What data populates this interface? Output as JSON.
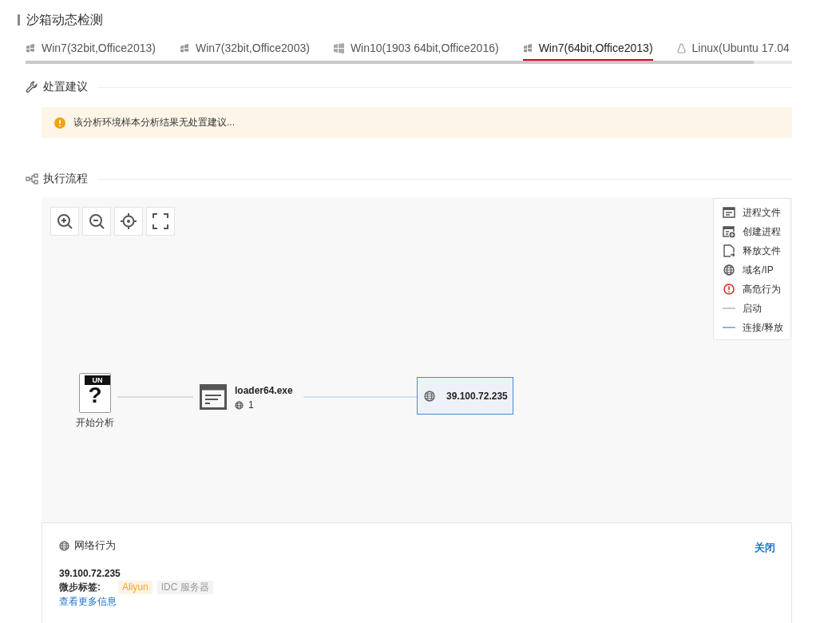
{
  "page_title": "沙箱动态检测",
  "tabs": [
    {
      "label": "Win7(32bit,Office2013)",
      "kind": "windows7",
      "selected": false
    },
    {
      "label": "Win7(32bit,Office2003)",
      "kind": "windows7",
      "selected": false
    },
    {
      "label": "Win10(1903 64bit,Office2016)",
      "kind": "windows10",
      "selected": false
    },
    {
      "label": "Win7(64bit,Office2013)",
      "kind": "windows7",
      "selected": true
    },
    {
      "label": "Linux(Ubuntu 17.04",
      "kind": "linux",
      "selected": false
    }
  ],
  "advice": {
    "title": "处置建议",
    "message": "该分析环境样本分析结果无处置建议..."
  },
  "flow": {
    "title": "执行流程",
    "legend": [
      {
        "kind": "process-file",
        "label": "进程文件"
      },
      {
        "kind": "create-process",
        "label": "创建进程"
      },
      {
        "kind": "release-file",
        "label": "释放文件"
      },
      {
        "kind": "domain",
        "label": "域名/IP"
      },
      {
        "kind": "danger",
        "label": "高危行为"
      },
      {
        "kind": "start-line",
        "label": "启动"
      },
      {
        "kind": "connect-line",
        "label": "连接/释放"
      }
    ],
    "start_node": {
      "badge": "UN",
      "symbol": "?",
      "label": "开始分析"
    },
    "process_node": {
      "name": "loader64.exe",
      "network_count": "1"
    },
    "ip_node": {
      "address": "39.100.72.235",
      "selected": true
    }
  },
  "network_panel": {
    "title": "网络行为",
    "close": "关闭",
    "address": "39.100.72.235",
    "tags_label": "微步标签:",
    "tags": [
      {
        "text": "Aliyun",
        "color": "#f5a623"
      },
      {
        "text": "IDC 服务器",
        "color": "#999999"
      }
    ],
    "more_link": "查看更多信息"
  }
}
